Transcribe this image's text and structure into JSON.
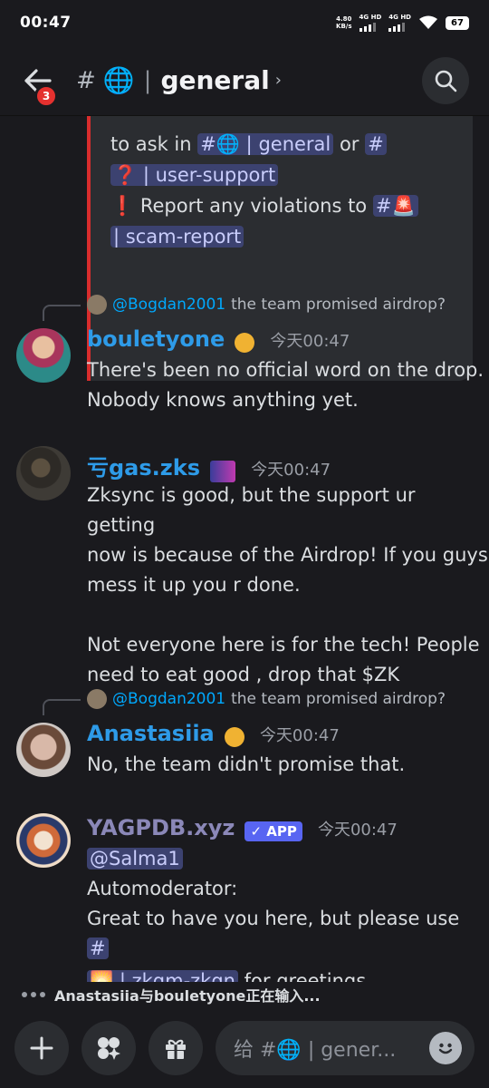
{
  "status": {
    "time": "00:47",
    "net_speed_value": "4.80",
    "net_speed_unit": "KB/s",
    "net1": "4G HD",
    "net2": "4G HD",
    "battery": "67"
  },
  "header": {
    "back_badge": "3",
    "channel_icon": "🌐",
    "channel_name": "general",
    "chevron": "›"
  },
  "embed": {
    "line1": "to ask in",
    "ch1_icon": "#🌐",
    "ch1_name": "general",
    "or": "or",
    "ch2_icon": "#",
    "ch2_emoji": "❓",
    "ch2_name": "user-support",
    "line3_emoji": "❗",
    "line3": "Report any violations to",
    "ch3_icon": "#🚨",
    "ch3_name": "scam-report"
  },
  "messages": [
    {
      "reply_user": "@Bogdan2001",
      "reply_text": "the team promised airdrop?",
      "username": "bouletyone",
      "username_color": "#2e9be8",
      "timestamp": "今天00:47",
      "lines": [
        "There's been no official word on the drop.",
        "Nobody knows anything yet."
      ]
    },
    {
      "username": "亏gas.zks",
      "username_color": "#2e9be8",
      "timestamp": "今天00:47",
      "lines": [
        "Zksync is good, but the support ur getting",
        "now is because of the Airdrop! If you guys",
        "mess it up you  r done.",
        "",
        "Not everyone here is for the tech! People",
        "need to eat good , drop that $ZK"
      ]
    },
    {
      "reply_user": "@Bogdan2001",
      "reply_text": "the team promised airdrop?",
      "username": "Anastasiia",
      "username_color": "#2e9be8",
      "timestamp": "今天00:47",
      "lines": [
        "No, the team didn't promise that."
      ]
    },
    {
      "username": "YAGPDB.xyz",
      "username_color": "#8b88b8",
      "app_tag": "✓ APP",
      "timestamp": "今天00:47",
      "mention": "@Salma1",
      "line1": "Automoderator:",
      "line2": "Great to have you here, but please use",
      "ch_icon": "#",
      "ch_emoji": "🌅",
      "ch_name": "zkgm-zkgn",
      "line3_tail": "for greetings."
    }
  ],
  "typing": "Anastasiia与bouletyone正在输入...",
  "composer": {
    "placeholder": "给 #🌐 | gener..."
  }
}
